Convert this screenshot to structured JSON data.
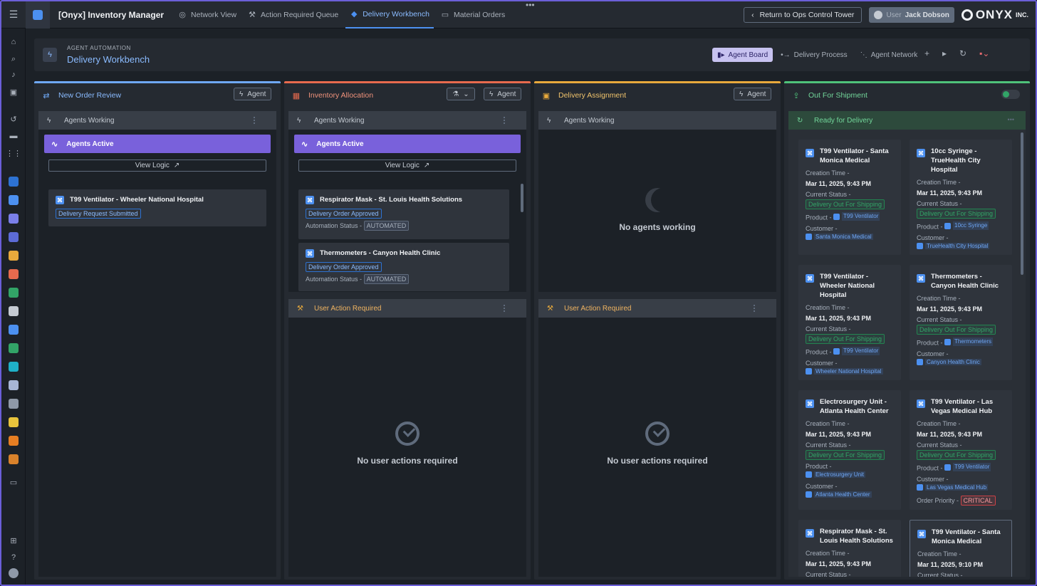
{
  "app": {
    "title": "[Onyx] Inventory Manager",
    "tabs": [
      {
        "label": "Network View",
        "icon": "globe-icon"
      },
      {
        "label": "Action Required Queue",
        "icon": "hammer-icon"
      },
      {
        "label": "Delivery Workbench",
        "icon": "cube-icon",
        "active": true
      },
      {
        "label": "Material Orders",
        "icon": "inbox-icon"
      }
    ],
    "return_label": "Return to Ops Control Tower",
    "user_label": "User",
    "user_name": "Jack Dobson",
    "logo_text": "ONYX",
    "logo_suffix": "INC."
  },
  "header": {
    "eyebrow": "Agent Automation",
    "title": "Delivery Workbench",
    "view_tabs": [
      "Agent Board",
      "Delivery Process",
      "Agent Network"
    ]
  },
  "common": {
    "agent_label": "Agent",
    "agents_working": "Agents Working",
    "agents_active": "Agents Active",
    "view_logic": "View Logic",
    "user_action_required": "User Action Required",
    "no_user_actions": "No user actions required",
    "no_agents_working": "No agents working",
    "ready_for_delivery": "Ready for Delivery",
    "automation_status_label": "Automation Status -",
    "creation_time_label": "Creation Time -",
    "current_status_label": "Current Status -",
    "product_label": "Product -",
    "customer_label": "Customer -",
    "order_priority_label": "Order Priority -"
  },
  "columns": [
    {
      "title": "New Order Review",
      "color": "#6fa8f5"
    },
    {
      "title": "Inventory Allocation",
      "color": "#e76a4e"
    },
    {
      "title": "Delivery Assignment",
      "color": "#e8a93c"
    },
    {
      "title": "Out For Shipment",
      "color": "#4fc27a"
    }
  ],
  "new_order_cards": [
    {
      "title": "T99 Ventilator - Wheeler National Hospital",
      "status": "Delivery Request Submitted"
    }
  ],
  "inventory_cards": [
    {
      "title": "Respirator Mask - St. Louis Health Solutions",
      "status": "Delivery Order Approved",
      "automation": "AUTOMATED"
    },
    {
      "title": "Thermometers - Canyon Health Clinic",
      "status": "Delivery Order Approved",
      "automation": "AUTOMATED"
    }
  ],
  "shipment_cards": [
    {
      "title": "T99 Ventilator - Santa Monica Medical",
      "time": "Mar 11, 2025, 9:43 PM",
      "status": "Delivery Out For Shipping",
      "product": "T99 Ventilator",
      "customer": "Santa Monica Medical"
    },
    {
      "title": "10cc Syringe - TrueHealth City Hospital",
      "time": "Mar 11, 2025, 9:43 PM",
      "status": "Delivery Out For Shipping",
      "product": "10cc Syringe",
      "customer": "TrueHealth City Hospital"
    },
    {
      "title": "T99 Ventilator - Wheeler National Hospital",
      "time": "Mar 11, 2025, 9:43 PM",
      "status": "Delivery Out For Shipping",
      "product": "T99 Ventilator",
      "customer": "Wheeler National Hospital"
    },
    {
      "title": "Thermometers - Canyon Health Clinic",
      "time": "Mar 11, 2025, 9:43 PM",
      "status": "Delivery Out For Shipping",
      "product": "Thermometers",
      "customer": "Canyon Health Clinic"
    },
    {
      "title": "Electrosurgery Unit - Atlanta Health Center",
      "time": "Mar 11, 2025, 9:43 PM",
      "status": "Delivery Out For Shipping",
      "product": "Electrosurgery Unit",
      "customer": "Atlanta Health Center"
    },
    {
      "title": "T99 Ventilator - Las Vegas Medical Hub",
      "time": "Mar 11, 2025, 9:43 PM",
      "status": "Delivery Out For Shipping",
      "product": "T99 Ventilator",
      "customer": "Las Vegas Medical Hub",
      "priority": "CRITICAL"
    },
    {
      "title": "Respirator Mask - St. Louis Health Solutions",
      "time": "Mar 11, 2025, 9:43 PM"
    },
    {
      "title": "T99 Ventilator - Santa Monica Medical",
      "time": "Mar 11, 2025, 9:10 PM"
    }
  ]
}
